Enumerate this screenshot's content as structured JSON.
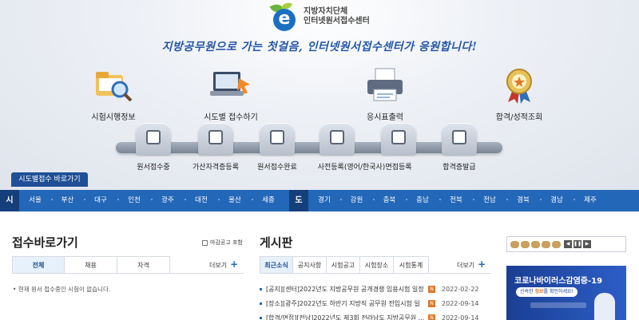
{
  "logo": {
    "line1": "지방자치단체",
    "line2": "인터넷원서접수센터"
  },
  "slogan": "지방공무원으로 가는 첫걸음, 인터넷원서접수센터가 응원합니다!",
  "main_menu": [
    {
      "label": "시험시행정보",
      "icon": "folder-search-icon"
    },
    {
      "label": "시도별 접수하기",
      "icon": "laptop-click-icon"
    },
    {
      "label": "응시표출력",
      "icon": "printer-icon"
    },
    {
      "label": "합격/성적조회",
      "icon": "award-medal-icon"
    }
  ],
  "sub_menu": [
    {
      "label": "원서접수중",
      "icon": "pencil-icon"
    },
    {
      "label": "가산자격증등록",
      "icon": "id-card-icon"
    },
    {
      "label": "원서접수완료",
      "icon": "checkbox-icon"
    },
    {
      "label": "사전등록(영어/한국사)",
      "icon": "document-edit-icon"
    },
    {
      "label": "면접등록",
      "icon": "interview-icon"
    },
    {
      "label": "합격증발급",
      "icon": "certificate-badge-icon"
    }
  ],
  "quick_label": "시도별접수 바로가기",
  "regions": {
    "si_label": "시",
    "si": [
      "서울",
      "부산",
      "대구",
      "인천",
      "광주",
      "대전",
      "울산",
      "세종"
    ],
    "do_label": "도",
    "do": [
      "경기",
      "강원",
      "충북",
      "충남",
      "전북",
      "전남",
      "경북",
      "경남",
      "제주"
    ]
  },
  "receipt": {
    "title": "접수바로가기",
    "checkbox_label": "마감공고 포함",
    "tabs": [
      "전체",
      "채용",
      "자격"
    ],
    "more": "더보기",
    "empty_message": "현재 원서 접수중인 시험이 없습니다."
  },
  "board": {
    "title": "게시판",
    "tabs": [
      "최근소식",
      "공지사항",
      "시험공고",
      "시험장소",
      "시험통계"
    ],
    "more": "더보기",
    "new_badge": "N",
    "items": [
      {
        "title": "[공지][센터]2022년도 지방공무원 공개경쟁 임용시험 일정",
        "date": "2022-02-22"
      },
      {
        "title": "[장소][광주]2022년도 하반기 지방직 공무원 전입시험 일",
        "date": "2022-09-14"
      },
      {
        "title": "[합격/면접][전남]2022년도 제3회 전라남도 지방공무원 ...",
        "date": "2022-09-14"
      }
    ]
  },
  "banner": {
    "title": "코로나바이러스감염증-19",
    "sub_pre": "신속한",
    "sub_em": "정보",
    "sub_post": "를 확인하세요!",
    "pager_controls": [
      "◀",
      "❚❚",
      "▶"
    ]
  },
  "colors": {
    "primary": "#2367b8",
    "dark": "#153f7a",
    "accent": "#e0782a"
  }
}
